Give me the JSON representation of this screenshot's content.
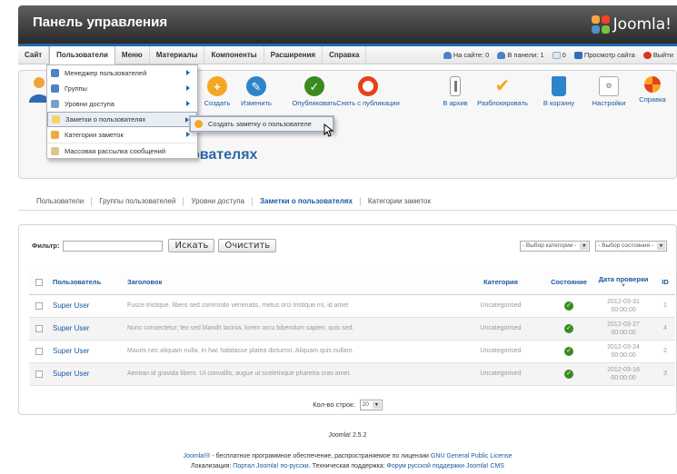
{
  "header": {
    "title": "Панель управления",
    "logo_text": "Joomla!"
  },
  "menubar": {
    "items": [
      "Сайт",
      "Пользователи",
      "Меню",
      "Материалы",
      "Компоненты",
      "Расширения",
      "Справка"
    ],
    "status": {
      "on_site": "На сайте: 0",
      "in_admin": "В панели: 1",
      "messages": "0",
      "view_site": "Просмотр сайта",
      "logout": "Выйти"
    }
  },
  "dropdown": {
    "items": [
      "Менеджер пользователей",
      "Группы",
      "Уровни доступа",
      "Заметки о пользователях",
      "Категории заметок",
      "Массовая рассылка сообщений"
    ],
    "submenu_item": "Создать заметку о пользователе"
  },
  "toolbar": {
    "new": "Создать",
    "edit": "Изменить",
    "publish": "Опубликовать",
    "unpublish": "Снять с публикации",
    "archive": "В архив",
    "checkin": "Разблокировать",
    "trash": "В корзину",
    "options": "Настройки",
    "help": "Справка"
  },
  "page_heading_fragment": "ователях",
  "tabs": [
    "Пользователи",
    "Группы пользователей",
    "Уровни доступа",
    "Заметки о пользователях",
    "Категории заметок"
  ],
  "filter": {
    "label": "Фильтр:",
    "value": "",
    "search_button": "Искать",
    "clear_button": "Очистить",
    "category_select": "- Выбор категории -",
    "state_select": "- Выбор состояния -"
  },
  "table": {
    "headers": {
      "user": "Пользователь",
      "subject": "Заголовок",
      "category": "Категория",
      "state": "Состояние",
      "review_date": "Дата проверки",
      "id": "ID"
    },
    "rows": [
      {
        "user": "Super User",
        "subject": "Fusce tristique, libero sed commodo venenatis, metus orci tristique mi, id amet",
        "category": "Uncategorised",
        "date": "2012-03-31",
        "time": "00:00:00",
        "id": "1"
      },
      {
        "user": "Super User",
        "subject": "Nunc consectetur; leo sed blandit lacinia, lorem arcu bibendum sapien, quis sed.",
        "category": "Uncategorised",
        "date": "2012-03-27",
        "time": "00:00:00",
        "id": "4"
      },
      {
        "user": "Super User",
        "subject": "Mauris nec aliquam nulla. In hac habitasse platea dictumst. Aliquam quis nullam.",
        "category": "Uncategorised",
        "date": "2012-03-24",
        "time": "00:00:00",
        "id": "2"
      },
      {
        "user": "Super User",
        "subject": "Aenean id gravida libero. Ut convallis, augue ut scelerisque pharetra cras amet.",
        "category": "Uncategorised",
        "date": "2012-03-18",
        "time": "00:00:00",
        "id": "3"
      }
    ],
    "rows_label": "Кол-во строк:",
    "rows_value": "20"
  },
  "footer": {
    "version": "Joomla! 2.5.2",
    "line1_brand": "Joomla!®",
    "line1_text": " - бесплатное программное обеспечение, распространяемое по лицензии ",
    "line1_license": "GNU General Public License",
    "line2_label": "Локализация: ",
    "line2_portal": "Портал Joomla! по-русски",
    "line2_support_label": ". Техническая поддержка: ",
    "line2_forum": "Форум русской поддержки Joomla! CMS"
  },
  "colors": {
    "accent": "#1a59a0",
    "header_bg": "#3a3a3a",
    "ok_green": "#3a8b1f"
  }
}
